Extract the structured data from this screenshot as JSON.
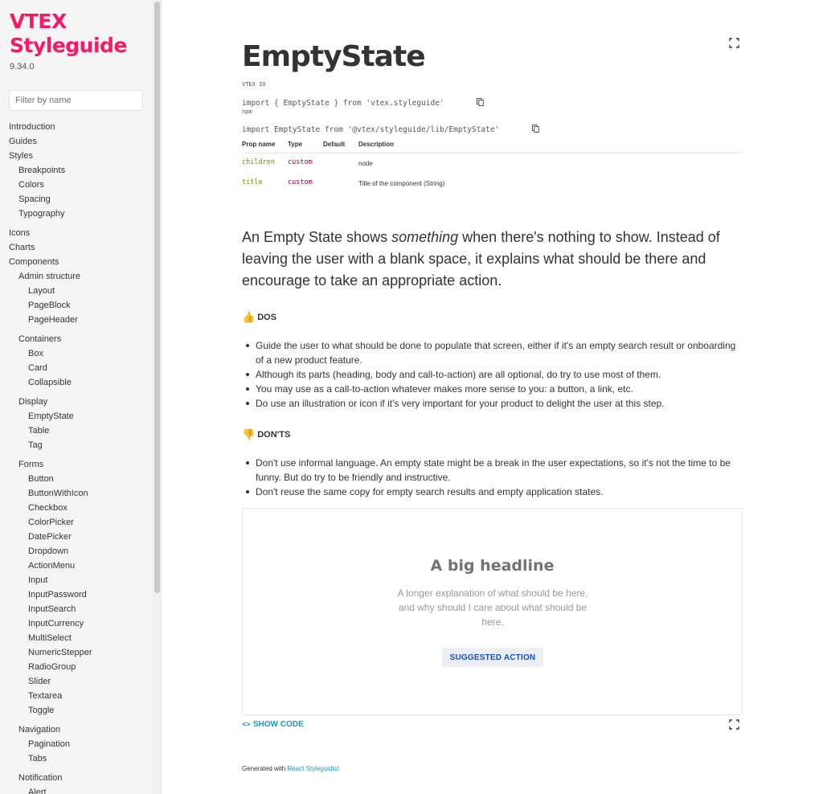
{
  "sidebar": {
    "brand_line1": "VTEX",
    "brand_line2": "Styleguide",
    "version": "9.34.0",
    "filter_placeholder": "Filter by name",
    "items": [
      {
        "label": "Introduction",
        "level": 0
      },
      {
        "label": "Guides",
        "level": 0
      },
      {
        "label": "Styles",
        "level": 0
      },
      {
        "label": "Breakpoints",
        "level": 1
      },
      {
        "label": "Colors",
        "level": 1
      },
      {
        "label": "Spacing",
        "level": 1
      },
      {
        "label": "Typography",
        "level": 1
      },
      {
        "label": "Icons",
        "level": 0
      },
      {
        "label": "Charts",
        "level": 0
      },
      {
        "label": "Components",
        "level": 0
      },
      {
        "label": "Admin structure",
        "level": 1
      },
      {
        "label": "Layout",
        "level": 2
      },
      {
        "label": "PageBlock",
        "level": 2
      },
      {
        "label": "PageHeader",
        "level": 2
      },
      {
        "label": "Containers",
        "level": 1
      },
      {
        "label": "Box",
        "level": 2
      },
      {
        "label": "Card",
        "level": 2
      },
      {
        "label": "Collapsible",
        "level": 2
      },
      {
        "label": "Display",
        "level": 1
      },
      {
        "label": "EmptyState",
        "level": 2
      },
      {
        "label": "Table",
        "level": 2
      },
      {
        "label": "Tag",
        "level": 2
      },
      {
        "label": "Forms",
        "level": 1
      },
      {
        "label": "Button",
        "level": 2
      },
      {
        "label": "ButtonWithIcon",
        "level": 2
      },
      {
        "label": "Checkbox",
        "level": 2
      },
      {
        "label": "ColorPicker",
        "level": 2
      },
      {
        "label": "DatePicker",
        "level": 2
      },
      {
        "label": "Dropdown",
        "level": 2
      },
      {
        "label": "ActionMenu",
        "level": 2
      },
      {
        "label": "Input",
        "level": 2
      },
      {
        "label": "InputPassword",
        "level": 2
      },
      {
        "label": "InputSearch",
        "level": 2
      },
      {
        "label": "InputCurrency",
        "level": 2
      },
      {
        "label": "MultiSelect",
        "level": 2
      },
      {
        "label": "NumericStepper",
        "level": 2
      },
      {
        "label": "RadioGroup",
        "level": 2
      },
      {
        "label": "Slider",
        "level": 2
      },
      {
        "label": "Textarea",
        "level": 2
      },
      {
        "label": "Toggle",
        "level": 2
      },
      {
        "label": "Navigation",
        "level": 1
      },
      {
        "label": "Pagination",
        "level": 2
      },
      {
        "label": "Tabs",
        "level": 2
      },
      {
        "label": "Notification",
        "level": 1
      },
      {
        "label": "Alert",
        "level": 2
      }
    ]
  },
  "main": {
    "title": "EmptyState",
    "imports": [
      {
        "label": "VTEX IO",
        "code": "import { EmptyState } from 'vtex.styleguide'"
      },
      {
        "label": "npm",
        "code": "import EmptyState from '@vtex/styleguide/lib/EmptyState'"
      }
    ],
    "props_table": {
      "headers": [
        "Prop name",
        "Type",
        "Default",
        "Description"
      ],
      "rows": [
        {
          "name": "children",
          "type": "custom",
          "default": "",
          "description": "node"
        },
        {
          "name": "title",
          "type": "custom",
          "default": "",
          "description": "Title of the component (String)"
        }
      ]
    },
    "lead_before": "An Empty State shows ",
    "lead_em": "something",
    "lead_after": " when there's nothing to show. Instead of leaving the user with a blank space, it explains what should be there and encourage to take an appropriate action.",
    "dos": {
      "emoji": "👍",
      "heading": "DOS",
      "items": [
        "Guide the user to what should be done to populate that screen, either if it's an empty search result or onboarding of a new product feature.",
        "Although its parts (heading, body and call-to-action) are all optional, do try to use most of them.",
        "You may use as a call-to-action whatever makes more sense to you: a button, a link, etc.",
        "Do use an illustration or icon if it's very important for your product to delight the user at this step."
      ]
    },
    "donts": {
      "emoji": "👎",
      "heading": "DON'TS",
      "items": [
        "Don't use informal language. An empty state might be a break in the user expectations, so it's not the time to be funny. But do try to be friendly and instructive.",
        "Don't reuse the same copy for empty search results and empty application states."
      ]
    },
    "example": {
      "headline": "A big headline",
      "text": "A longer explanation of what should be here, and why should I care about what should be here.",
      "action_label": "SUGGESTED ACTION"
    },
    "show_code": {
      "chevrons": "<>",
      "label": "SHOW CODE"
    },
    "footer": {
      "prefix": "Generated with ",
      "link": "React Styleguidist"
    }
  },
  "colors": {
    "brand": "#f71963",
    "link": "#1e98c7",
    "action_text": "#134cd8",
    "prop_name": "#669900",
    "prop_type": "#990055"
  }
}
